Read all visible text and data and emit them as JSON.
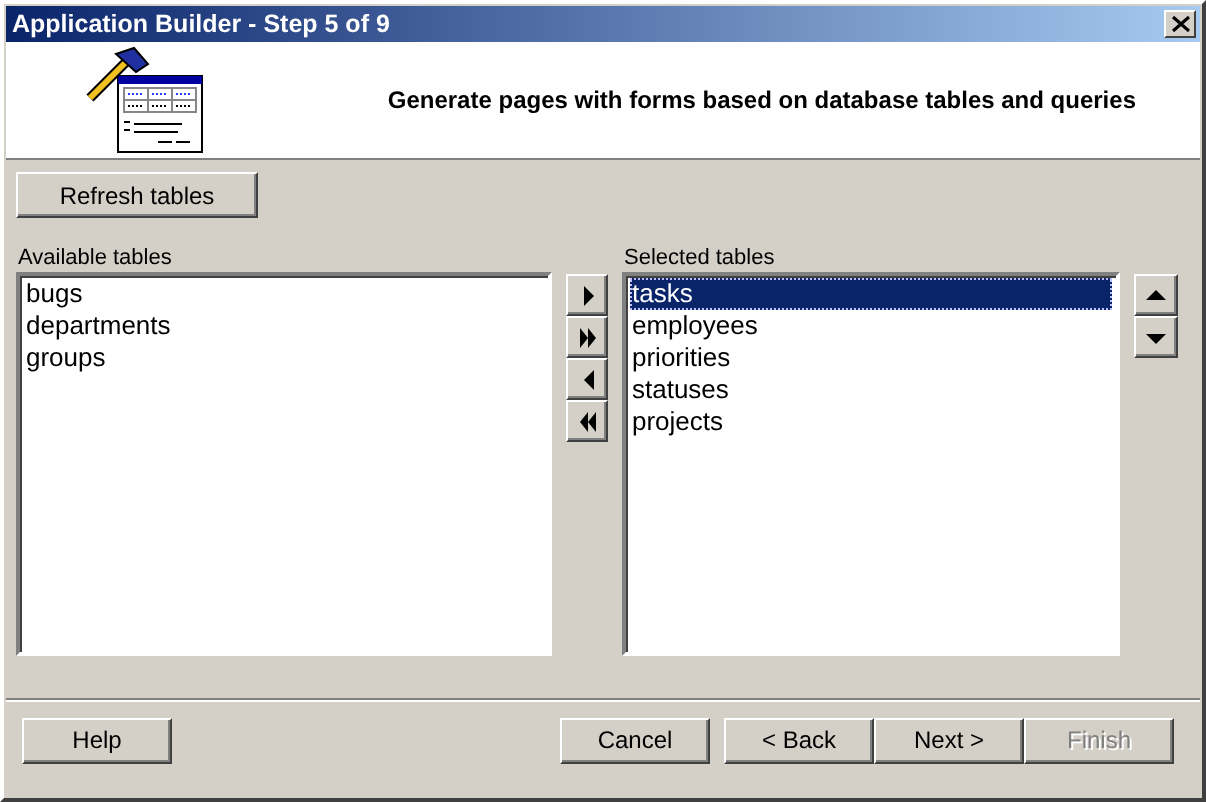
{
  "window": {
    "title": "Application Builder - Step 5 of 9"
  },
  "header": {
    "description": "Generate pages with forms based on database tables and queries"
  },
  "refresh_button": {
    "label": "Refresh tables"
  },
  "available": {
    "label": "Available tables",
    "items": [
      {
        "text": "bugs",
        "selected": false
      },
      {
        "text": "departments",
        "selected": false
      },
      {
        "text": "groups",
        "selected": false
      }
    ]
  },
  "move_buttons": [
    {
      "kind": "add"
    },
    {
      "kind": "add_all"
    },
    {
      "kind": "remove"
    },
    {
      "kind": "remove_all"
    }
  ],
  "selected": {
    "label": "Selected tables",
    "items": [
      {
        "text": "tasks",
        "selected": true
      },
      {
        "text": "employees",
        "selected": false
      },
      {
        "text": "priorities",
        "selected": false
      },
      {
        "text": "statuses",
        "selected": false
      },
      {
        "text": "projects",
        "selected": false
      }
    ]
  },
  "order_buttons": [
    {
      "kind": "up"
    },
    {
      "kind": "down"
    }
  ],
  "footer": {
    "help": {
      "label": "Help",
      "disabled": false
    },
    "buttons": [
      {
        "label": "Cancel",
        "disabled": false
      },
      {
        "label": "< Back",
        "disabled": false
      },
      {
        "label": "Next >",
        "disabled": false
      },
      {
        "label": "Finish",
        "disabled": true
      }
    ]
  }
}
